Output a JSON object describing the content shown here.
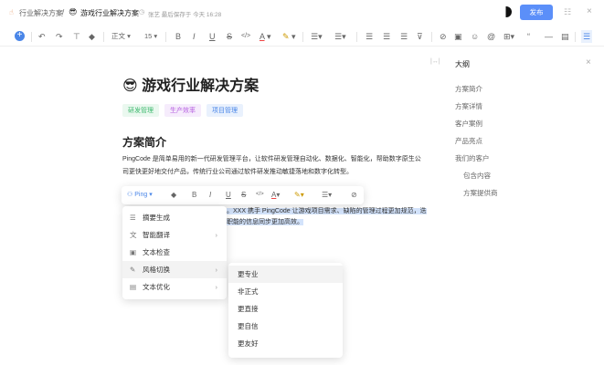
{
  "header": {
    "breadcrumb_parent": "行业解决方案",
    "separator": "/",
    "doc_title": "游戏行业解决方案",
    "save_status": "张艺 最后保存于 今天 16:28",
    "publish": "发布"
  },
  "toolbar": {
    "paragraph": "正文",
    "font_size": "15"
  },
  "doc": {
    "title": "游戏行业解决方案",
    "tags": [
      {
        "label": "研发管理",
        "color": "#3fb96f",
        "bg": "#eaf8ef"
      },
      {
        "label": "生产效率",
        "color": "#b55ee0",
        "bg": "#f6ecfc"
      },
      {
        "label": "项目管理",
        "color": "#4a86e8",
        "bg": "#e9f1fd"
      }
    ],
    "heading": "方案简介",
    "para_line1": "PingCode 是简单易用的新一代研发管理平台，让软件研发管理自动化、数据化、智能化，帮助数字原生公",
    "para_line2": "司更快更好地交付产品，传统行业公司通过软件研发推动敏捷落地和数字化转型。",
    "sel_line1": "。XXX 携手 PingCode 让游戏项目需求、缺陷的管理过程更加规范，迭",
    "sel_line2": "职能的信息同步更加高效。"
  },
  "float_toolbar": {
    "ai_label": "Ping"
  },
  "ai_menu": [
    {
      "label": "摘要生成",
      "icon": "☰",
      "sub": false
    },
    {
      "label": "智能翻译",
      "icon": "文",
      "sub": true
    },
    {
      "label": "文本检查",
      "icon": "▣",
      "sub": false
    },
    {
      "label": "风格切换",
      "icon": "✎",
      "sub": true
    },
    {
      "label": "文本优化",
      "icon": "▤",
      "sub": true
    }
  ],
  "style_menu": [
    "更专业",
    "非正式",
    "更直接",
    "更自信",
    "更友好"
  ],
  "outline": {
    "title": "大纲",
    "items": [
      "方案简介",
      "方案详情",
      "客户案例",
      "产品亮点",
      "我们的客户",
      "包含内容",
      "方案提供商"
    ]
  }
}
